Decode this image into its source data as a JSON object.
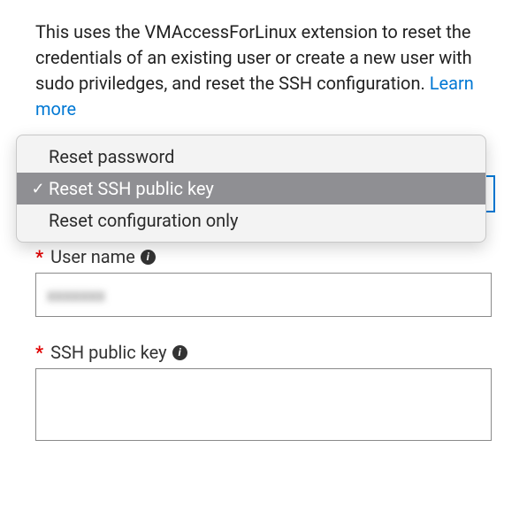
{
  "description": {
    "text": "This uses the VMAccessForLinux extension to reset the credentials of an existing user or create a new user with sudo priviledges, and reset the SSH configuration. ",
    "link_text": "Learn more"
  },
  "mode_dropdown": {
    "options": [
      {
        "label": "Reset password",
        "selected": false
      },
      {
        "label": "Reset SSH public key",
        "selected": true
      },
      {
        "label": "Reset configuration only",
        "selected": false
      }
    ]
  },
  "fields": {
    "username": {
      "label": "User name",
      "required_marker": "*",
      "value_obscured": "xxxxxxx"
    },
    "ssh_key": {
      "label": "SSH public key",
      "required_marker": "*",
      "value": ""
    }
  },
  "icons": {
    "info": "i",
    "check": "✓"
  }
}
